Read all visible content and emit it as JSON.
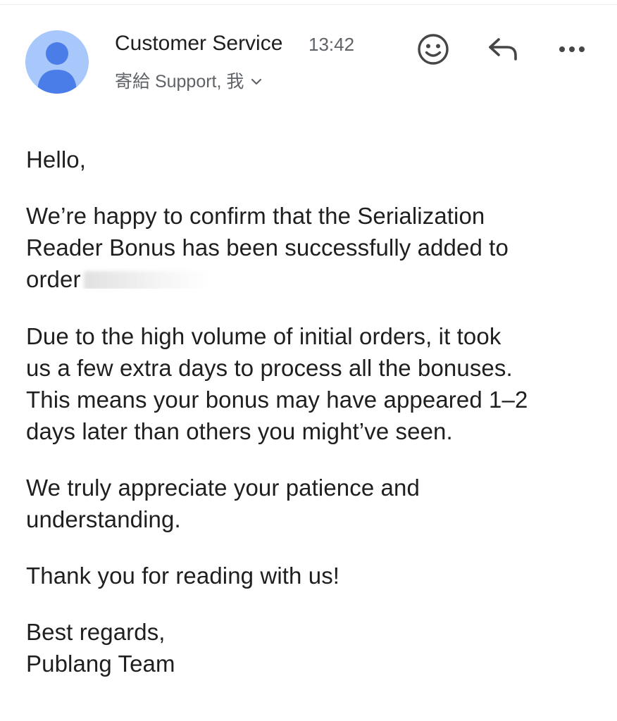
{
  "header": {
    "sender_name": "Customer Service",
    "time": "13:42",
    "recipients": "寄給 Support, 我",
    "avatar_icon": "person-icon",
    "avatar_color": "#a8c7fa",
    "avatar_figure_color": "#4a7de8",
    "actions": [
      {
        "name": "emoji-reaction",
        "icon": "smiley-icon"
      },
      {
        "name": "reply",
        "icon": "reply-icon"
      },
      {
        "name": "more",
        "icon": "more-horizontal-icon"
      }
    ]
  },
  "message": {
    "greeting": "Hello,",
    "para1_line1": "We’re happy to confirm that the Serialization",
    "para1_line2": "Reader Bonus has been successfully added to",
    "para1_line3": "order",
    "para2_line1": "Due to the high volume of initial orders, it took",
    "para2_line2": "us a few extra days to process all the bonuses.",
    "para2_line3": "This means your bonus may have appeared 1–2",
    "para2_line4": "days later than others you might’ve seen.",
    "para3_line1": "We truly appreciate your patience and",
    "para3_line2": "understanding.",
    "para4": "Thank you for reading with us!",
    "signoff": "Best regards,",
    "signature": "Publang Team"
  }
}
